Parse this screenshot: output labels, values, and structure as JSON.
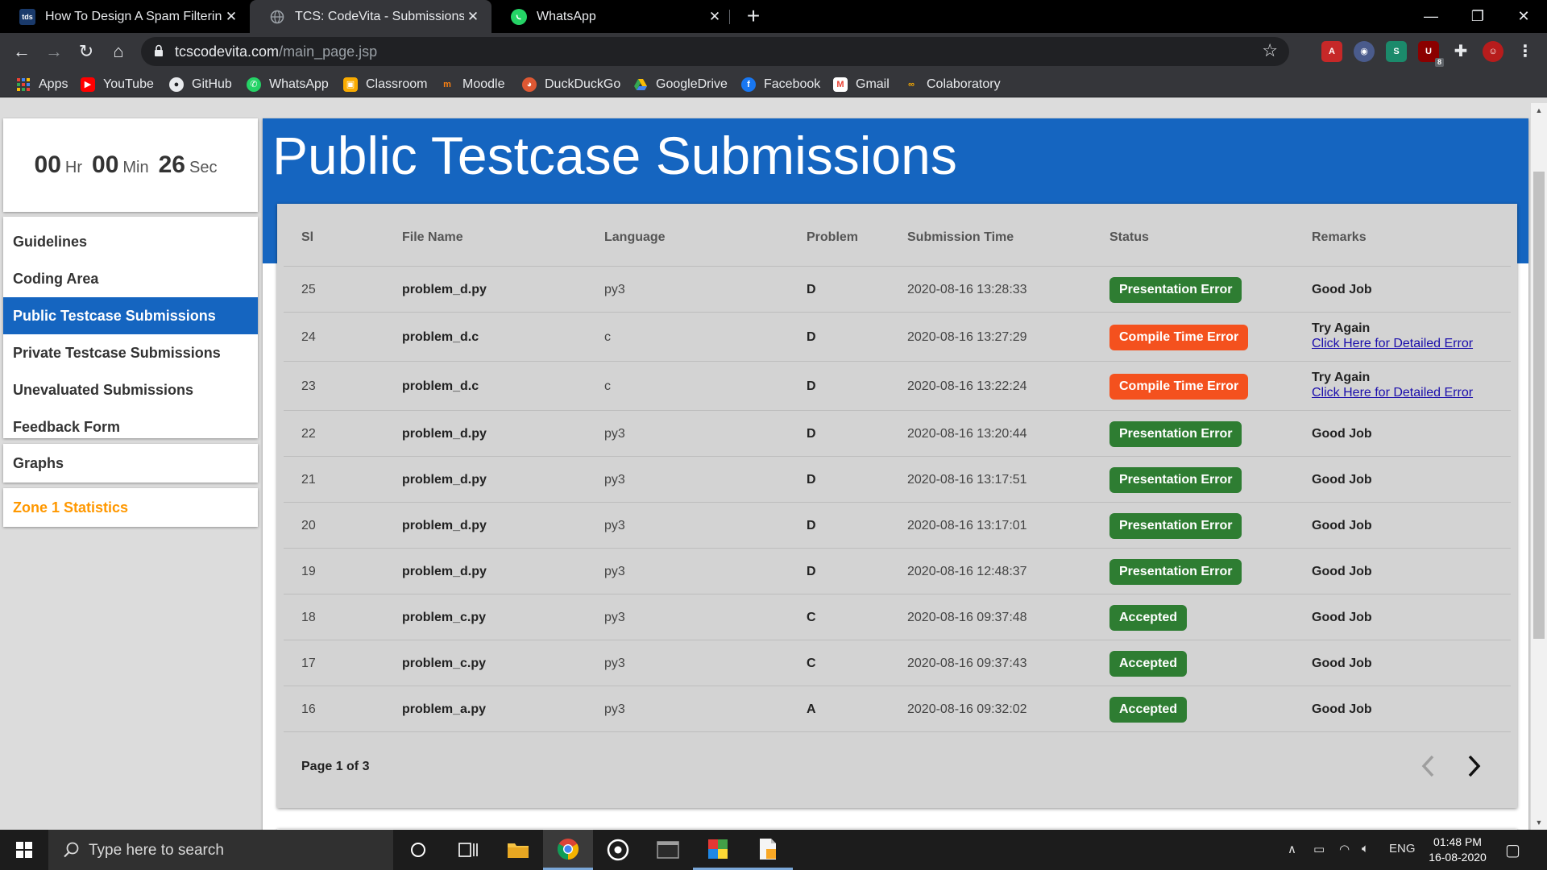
{
  "browser": {
    "tabs": [
      {
        "title": "How To Design A Spam Filtering",
        "favicon": "tds-icon"
      },
      {
        "title": "TCS: CodeVita - Submissions",
        "favicon": "globe-icon"
      },
      {
        "title": "WhatsApp",
        "favicon": "whatsapp-icon"
      }
    ],
    "url_domain": "tcscodevita.com",
    "url_path": "/main_page.jsp",
    "bookmarks": [
      "Apps",
      "YouTube",
      "GitHub",
      "WhatsApp",
      "Classroom",
      "Moodle",
      "DuckDuckGo",
      "GoogleDrive",
      "Facebook",
      "Gmail",
      "Colaboratory"
    ],
    "extension_badge": "8"
  },
  "timer": {
    "hours": "00",
    "hours_unit": "Hr",
    "minutes": "00",
    "minutes_unit": "Min",
    "seconds": "26",
    "seconds_unit": "Sec"
  },
  "sidebar": {
    "items": [
      {
        "label": "Guidelines",
        "active": false
      },
      {
        "label": "Coding Area",
        "active": false
      },
      {
        "label": "Public Testcase Submissions",
        "active": true
      },
      {
        "label": "Private Testcase Submissions",
        "active": false
      },
      {
        "label": "Unevaluated Submissions",
        "active": false
      },
      {
        "label": "Feedback Form",
        "active": false
      }
    ],
    "graphs": "Graphs",
    "zone_stats": "Zone 1 Statistics"
  },
  "main": {
    "title": "Public Testcase Submissions",
    "columns": [
      "Sl",
      "File Name",
      "Language",
      "Problem",
      "Submission Time",
      "Status",
      "Remarks"
    ],
    "rows": [
      {
        "sl": "25",
        "file": "problem_d.py",
        "lang": "py3",
        "problem": "D",
        "time": "2020-08-16 13:28:33",
        "status": "Presentation Error",
        "status_type": "green",
        "remark": "Good Job",
        "link": ""
      },
      {
        "sl": "24",
        "file": "problem_d.c",
        "lang": "c",
        "problem": "D",
        "time": "2020-08-16 13:27:29",
        "status": "Compile Time Error",
        "status_type": "orange",
        "remark": "Try Again",
        "link": "Click Here for Detailed Error"
      },
      {
        "sl": "23",
        "file": "problem_d.c",
        "lang": "c",
        "problem": "D",
        "time": "2020-08-16 13:22:24",
        "status": "Compile Time Error",
        "status_type": "orange",
        "remark": "Try Again",
        "link": "Click Here for Detailed Error"
      },
      {
        "sl": "22",
        "file": "problem_d.py",
        "lang": "py3",
        "problem": "D",
        "time": "2020-08-16 13:20:44",
        "status": "Presentation Error",
        "status_type": "green",
        "remark": "Good Job",
        "link": ""
      },
      {
        "sl": "21",
        "file": "problem_d.py",
        "lang": "py3",
        "problem": "D",
        "time": "2020-08-16 13:17:51",
        "status": "Presentation Error",
        "status_type": "green",
        "remark": "Good Job",
        "link": ""
      },
      {
        "sl": "20",
        "file": "problem_d.py",
        "lang": "py3",
        "problem": "D",
        "time": "2020-08-16 13:17:01",
        "status": "Presentation Error",
        "status_type": "green",
        "remark": "Good Job",
        "link": ""
      },
      {
        "sl": "19",
        "file": "problem_d.py",
        "lang": "py3",
        "problem": "D",
        "time": "2020-08-16 12:48:37",
        "status": "Presentation Error",
        "status_type": "green",
        "remark": "Good Job",
        "link": ""
      },
      {
        "sl": "18",
        "file": "problem_c.py",
        "lang": "py3",
        "problem": "C",
        "time": "2020-08-16 09:37:48",
        "status": "Accepted",
        "status_type": "green",
        "remark": "Good Job",
        "link": ""
      },
      {
        "sl": "17",
        "file": "problem_c.py",
        "lang": "py3",
        "problem": "C",
        "time": "2020-08-16 09:37:43",
        "status": "Accepted",
        "status_type": "green",
        "remark": "Good Job",
        "link": ""
      },
      {
        "sl": "16",
        "file": "problem_a.py",
        "lang": "py3",
        "problem": "A",
        "time": "2020-08-16 09:32:02",
        "status": "Accepted",
        "status_type": "green",
        "remark": "Good Job",
        "link": ""
      }
    ],
    "pagination": "Page 1 of 3"
  },
  "taskbar": {
    "search_placeholder": "Type here to search",
    "language": "ENG",
    "time": "01:48 PM",
    "date": "16-08-2020"
  },
  "colors": {
    "primary_blue": "#1565c0",
    "status_green": "#2e7d32",
    "status_orange": "#f4511e",
    "zone_orange": "#ff9800"
  }
}
